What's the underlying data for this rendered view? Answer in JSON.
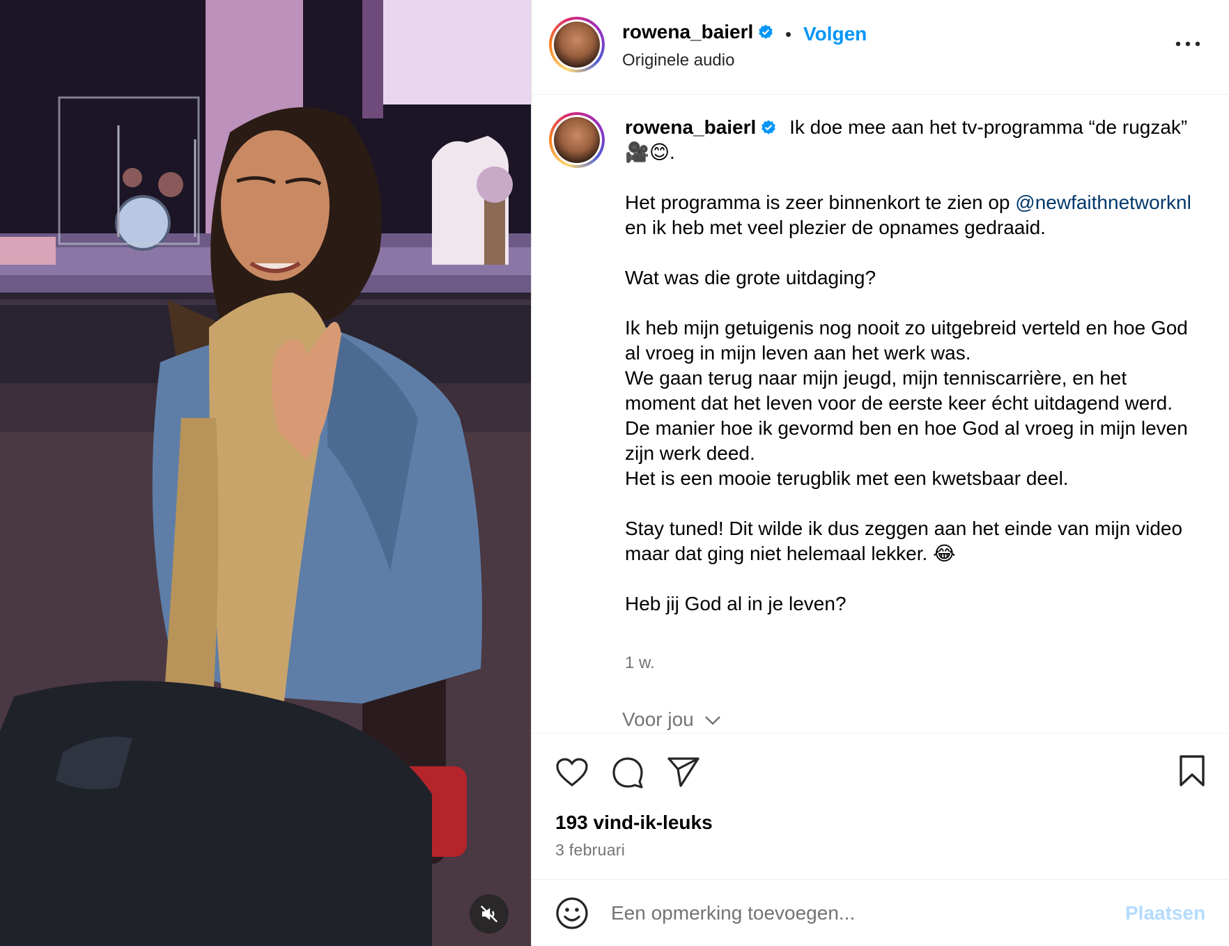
{
  "post": {
    "username": "rowena_baierl",
    "verified": true,
    "separator": "•",
    "follow_label": "Volgen",
    "audio_label": "Originele audio",
    "more_icon": "more-horizontal-icon"
  },
  "caption": {
    "username": "rowena_baierl",
    "line1_text": "Ik doe mee aan het tv-programma “de rugzak”",
    "line1_emoji": "🎥😊.",
    "para2_before": "Het programma is zeer binnenkort te zien op",
    "para2_mention": "@newfaithnetworknl",
    "para2_after": "en ik heb met veel plezier de opnames gedraaid.",
    "para3": "Wat was die grote uitdaging?",
    "para4_a": "Ik heb mijn getuigenis nog nooit zo uitgebreid verteld en hoe God al vroeg in mijn leven aan het werk was.",
    "para4_b": "We gaan terug naar mijn jeugd, mijn tenniscarrière, en het moment dat het leven voor de eerste keer écht uitdagend werd. De manier hoe ik gevormd ben en hoe God al vroeg in mijn leven zijn werk deed.",
    "para4_c": "Het is een mooie terugblik met een kwetsbaar deel.",
    "para5": "Stay tuned! Dit wilde ik dus zeggen aan het einde van mijn video maar dat ging niet helemaal lekker. 😂",
    "para6": "Heb jij God al in je leven?",
    "time_ago": "1 w."
  },
  "for_you": {
    "label": "Voor jou",
    "icon": "chevron-down-icon"
  },
  "actions": {
    "like_icon": "heart-icon",
    "comment_icon": "comment-icon",
    "share_icon": "send-icon",
    "save_icon": "bookmark-icon",
    "likes_text": "193 vind-ik-leuks",
    "date_text": "3 februari"
  },
  "comment": {
    "emoji_icon": "smiley-icon",
    "placeholder": "Een opmerking toevoegen...",
    "post_label": "Plaatsen"
  },
  "video": {
    "mute_icon": "muted-speaker-icon"
  },
  "colors": {
    "accent_blue": "#0095f6",
    "mention_blue": "#00376b",
    "secondary_text": "#737373",
    "post_disabled": "#b3dbff"
  }
}
